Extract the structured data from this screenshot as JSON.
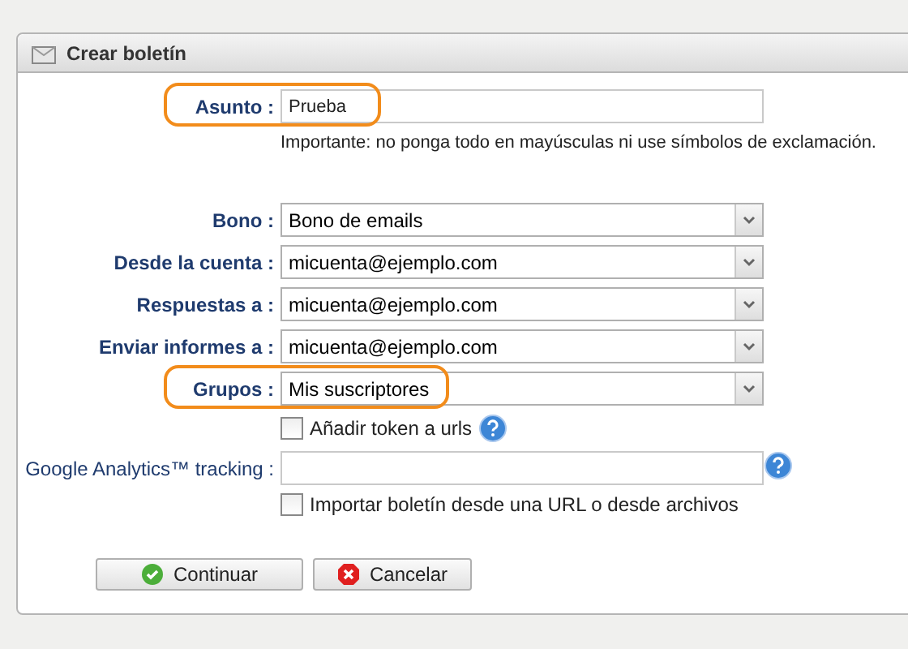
{
  "window": {
    "title": "Crear boletín"
  },
  "fields": [
    {
      "kind": "text",
      "label": "Asunto :",
      "bold_label": true,
      "value": "Prueba",
      "highlighted": true,
      "note": "Importante: no ponga todo en mayúsculas ni use símbolos de exclamación."
    },
    {
      "kind": "spacer"
    },
    {
      "kind": "select",
      "label": "Bono :",
      "bold_label": true,
      "value": "Bono de emails",
      "highlighted": false
    },
    {
      "kind": "select",
      "label": "Desde la cuenta :",
      "bold_label": true,
      "value": "micuenta@ejemplo.com",
      "highlighted": false
    },
    {
      "kind": "select",
      "label": "Respuestas a :",
      "bold_label": true,
      "value": "micuenta@ejemplo.com",
      "highlighted": false
    },
    {
      "kind": "select",
      "label": "Enviar informes a :",
      "bold_label": true,
      "value": "micuenta@ejemplo.com",
      "highlighted": false
    },
    {
      "kind": "select",
      "label": "Grupos :",
      "bold_label": true,
      "value": "Mis suscriptores",
      "highlighted": true
    },
    {
      "kind": "checkbox",
      "text": "Añadir token a urls",
      "checked": false,
      "help": true
    },
    {
      "kind": "text",
      "label": "Google Analytics™ tracking :",
      "bold_label": false,
      "highlighted": false,
      "help": true
    },
    {
      "kind": "checkbox",
      "text": "Importar boletín desde una URL o desde archivos",
      "checked": false,
      "help": false
    }
  ],
  "buttons": [
    {
      "kind": "ok",
      "label": "Continuar"
    },
    {
      "kind": "cancel",
      "label": "Cancelar"
    }
  ]
}
